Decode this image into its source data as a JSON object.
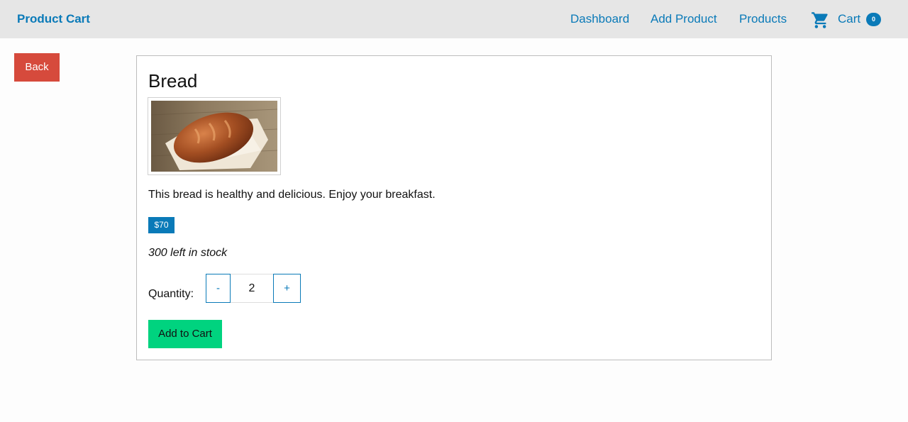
{
  "navbar": {
    "brand": "Product Cart",
    "links": {
      "dashboard": "Dashboard",
      "add_product": "Add Product",
      "products": "Products"
    },
    "cart": {
      "icon": "shopping-cart-icon",
      "label": "Cart",
      "count": "0"
    }
  },
  "back_button": "Back",
  "product": {
    "title": "Bread",
    "image": "bread-loaf-photo",
    "description": "This bread is healthy and delicious. Enjoy your breakfast.",
    "price": "$70",
    "stock": "300 left in stock",
    "quantity": {
      "label": "Quantity:",
      "decrement": "-",
      "value": "2",
      "increment": "+"
    },
    "add_to_cart": "Add to Cart"
  },
  "colors": {
    "accent": "#0a7ab8",
    "back_button": "#d64a3c",
    "add_to_cart": "#00d37f",
    "navbar_bg": "#e6e6e6"
  }
}
